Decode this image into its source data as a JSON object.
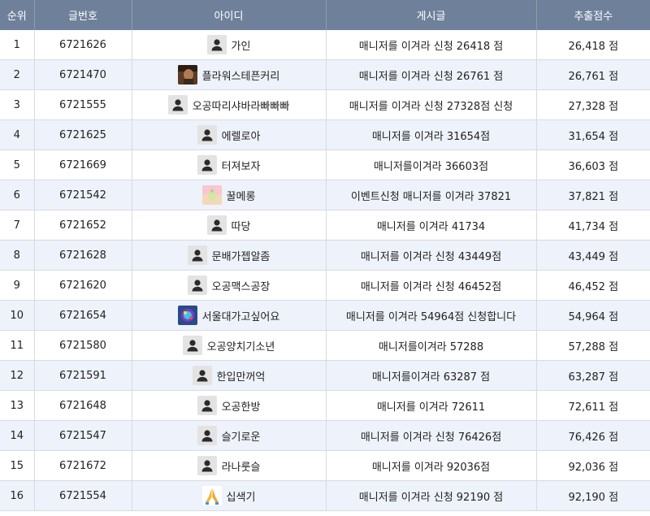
{
  "headers": {
    "rank": "순위",
    "post_no": "글번호",
    "user_id": "아이디",
    "post": "게시글",
    "score": "추출점수"
  },
  "rows": [
    {
      "rank": "1",
      "post_no": "6721626",
      "user": "가인",
      "avatar": "default-person-icon",
      "post": "매니저를 이겨라 신청 26418 점",
      "score": "26,418 점"
    },
    {
      "rank": "2",
      "post_no": "6721470",
      "user": "플라워스테픈커리",
      "avatar": "photo-avatar",
      "post": "매니저를 이겨라 신청 26761 점",
      "score": "26,761 점"
    },
    {
      "rank": "3",
      "post_no": "6721555",
      "user": "오공따리샤바라빠빠빠",
      "avatar": "default-person-icon",
      "post": "매니저를 이겨라 신청 27328점 신청",
      "score": "27,328 점"
    },
    {
      "rank": "4",
      "post_no": "6721625",
      "user": "에렐로아",
      "avatar": "default-person-icon",
      "post": "매니저를 이겨라 31654점",
      "score": "31,654 점"
    },
    {
      "rank": "5",
      "post_no": "6721669",
      "user": "터져보자",
      "avatar": "default-person-icon",
      "post": "매니저를이겨라 36603점",
      "score": "36,603 점"
    },
    {
      "rank": "6",
      "post_no": "6721542",
      "user": "꿀메롱",
      "avatar": "pastel-avatar",
      "post": "이벤트신청 매니저를 이겨라 37821",
      "score": "37,821 점"
    },
    {
      "rank": "7",
      "post_no": "6721652",
      "user": "따당",
      "avatar": "default-person-icon",
      "post": "매니저를 이겨라 41734",
      "score": "41,734 점"
    },
    {
      "rank": "8",
      "post_no": "6721628",
      "user": "문배가젭알좀",
      "avatar": "default-person-icon",
      "post": "매니저를 이겨라 신청 43449점",
      "score": "43,449 점"
    },
    {
      "rank": "9",
      "post_no": "6721620",
      "user": "오공맥스공장",
      "avatar": "default-person-icon",
      "post": "매니저를 이겨라 신청 46452점",
      "score": "46,452 점"
    },
    {
      "rank": "10",
      "post_no": "6721654",
      "user": "서울대가고싶어요",
      "avatar": "colorful-avatar",
      "post": "매니저를 이겨라 54964점 신청합니다",
      "score": "54,964 점"
    },
    {
      "rank": "11",
      "post_no": "6721580",
      "user": "오공양치기소년",
      "avatar": "default-person-icon",
      "post": "매니저를이겨라 57288",
      "score": "57,288 점"
    },
    {
      "rank": "12",
      "post_no": "6721591",
      "user": "한입만꺼억",
      "avatar": "default-person-icon",
      "post": "매니저를이겨라 63287 점",
      "score": "63,287 점"
    },
    {
      "rank": "13",
      "post_no": "6721648",
      "user": "오공한방",
      "avatar": "default-person-icon",
      "post": "매니저를 이겨라 72611",
      "score": "72,611 점"
    },
    {
      "rank": "14",
      "post_no": "6721547",
      "user": "슬기로운",
      "avatar": "default-person-icon",
      "post": "매니저를 이겨라 신청 76426점",
      "score": "76,426 점"
    },
    {
      "rank": "15",
      "post_no": "6721672",
      "user": "라나룻슬",
      "avatar": "default-person-icon",
      "post": "매니저를 이겨라 92036점",
      "score": "92,036 점"
    },
    {
      "rank": "16",
      "post_no": "6721554",
      "user": "십색기",
      "avatar": "praying-hands-avatar",
      "post": "매니저를 이겨라 신청 92190 점",
      "score": "92,190 점"
    }
  ],
  "colors": {
    "header_bg": "#6f819a",
    "row_alt_bg": "#eef2fa",
    "border": "#d6dbe3"
  }
}
